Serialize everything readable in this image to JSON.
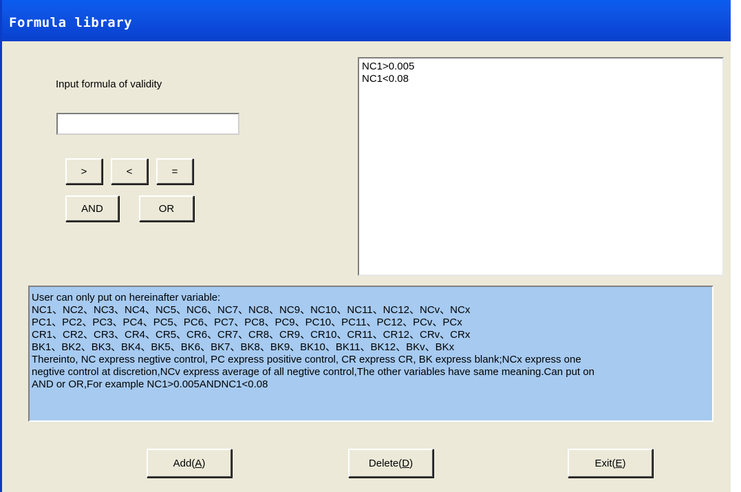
{
  "window": {
    "title": "Formula library"
  },
  "form": {
    "input_label": "Input formula of validity",
    "input_value": "",
    "operators": [
      ">",
      "<",
      "="
    ],
    "logic": [
      "AND",
      "OR"
    ]
  },
  "formula_list": {
    "items": [
      "NC1>0.005",
      "NC1<0.08"
    ]
  },
  "info": {
    "lines": [
      "User can only put on hereinafter variable:",
      "NC1、NC2、NC3、NC4、NC5、NC6、NC7、NC8、NC9、NC10、NC11、NC12、NCv、NCx",
      "PC1、PC2、PC3、PC4、PC5、PC6、PC7、PC8、PC9、PC10、PC11、PC12、PCv、PCx",
      "CR1、CR2、CR3、CR4、CR5、CR6、CR7、CR8、CR9、CR10、CR11、CR12、CRv、CRx",
      "BK1、BK2、BK3、BK4、BK5、BK6、BK7、BK8、BK9、BK10、BK11、BK12、BKv、BKx",
      "Thereinto, NC express negtive control, PC express positive control, CR express CR, BK express blank;NCx express one",
      "negtive control at discretion,NCv express average of all negtive control,The other variables have same meaning.Can put on",
      "AND or OR,For example NC1>0.005ANDNC1<0.08"
    ]
  },
  "buttons": {
    "add": {
      "text": "Add ",
      "paren_open": "(",
      "key": "A",
      "paren_close": ")"
    },
    "delete": {
      "text": "Delete ",
      "paren_open": "(",
      "key": "D",
      "paren_close": ")"
    },
    "exit": {
      "text": "Exit ",
      "paren_open": "(",
      "key": "E",
      "paren_close": ")"
    }
  }
}
